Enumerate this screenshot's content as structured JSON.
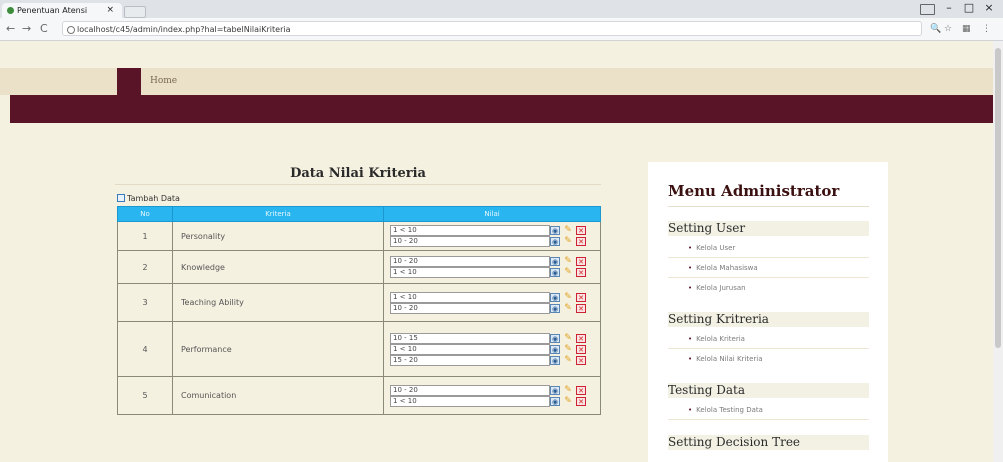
{
  "browser": {
    "tab_title": "Penentuan Atensi",
    "tab_close": "×",
    "url": "localhost/c45/admin/index.php?hal=tabelNilaiKriteria",
    "back": "←",
    "forward": "→",
    "reload": "C",
    "minimize": "–",
    "maximize": "□",
    "close": "×"
  },
  "nav": {
    "home_label": "Home"
  },
  "main": {
    "title": "Data Nilai Kriteria",
    "add_label": "Tambah Data",
    "columns": [
      "No",
      "Kriteria",
      "Nilai"
    ],
    "rows": [
      {
        "no": "1",
        "kriteria": "Personality",
        "nilai": [
          "1 < 10",
          "10 - 20"
        ]
      },
      {
        "no": "2",
        "kriteria": "Knowledge",
        "nilai": [
          "10 - 20",
          "1 < 10"
        ]
      },
      {
        "no": "3",
        "kriteria": "Teaching Ability",
        "nilai": [
          "1 < 10",
          "10 - 20"
        ]
      },
      {
        "no": "4",
        "kriteria": "Performance",
        "nilai": [
          "10 - 15",
          "1 < 10",
          "15 - 20"
        ]
      },
      {
        "no": "5",
        "kriteria": "Comunication",
        "nilai": [
          "10 - 20",
          "1 < 10"
        ]
      }
    ]
  },
  "sidebar": {
    "title": "Menu Administrator",
    "sections": [
      {
        "label": "Setting User",
        "items": [
          "Kelola User",
          "Kelola Mahasiswa",
          "Kelola Jurusan"
        ]
      },
      {
        "label": "Setting Kritreria",
        "items": [
          "Kelola Kriteria",
          "Kelola Nilai Kriteria"
        ]
      },
      {
        "label": "Testing Data",
        "items": [
          "Kelola Testing Data"
        ]
      },
      {
        "label": "Setting Decision Tree",
        "items": []
      }
    ]
  },
  "colors": {
    "accent": "#5a1428",
    "header_blue": "#29b6f0",
    "page_bg": "#f5f1e1"
  }
}
